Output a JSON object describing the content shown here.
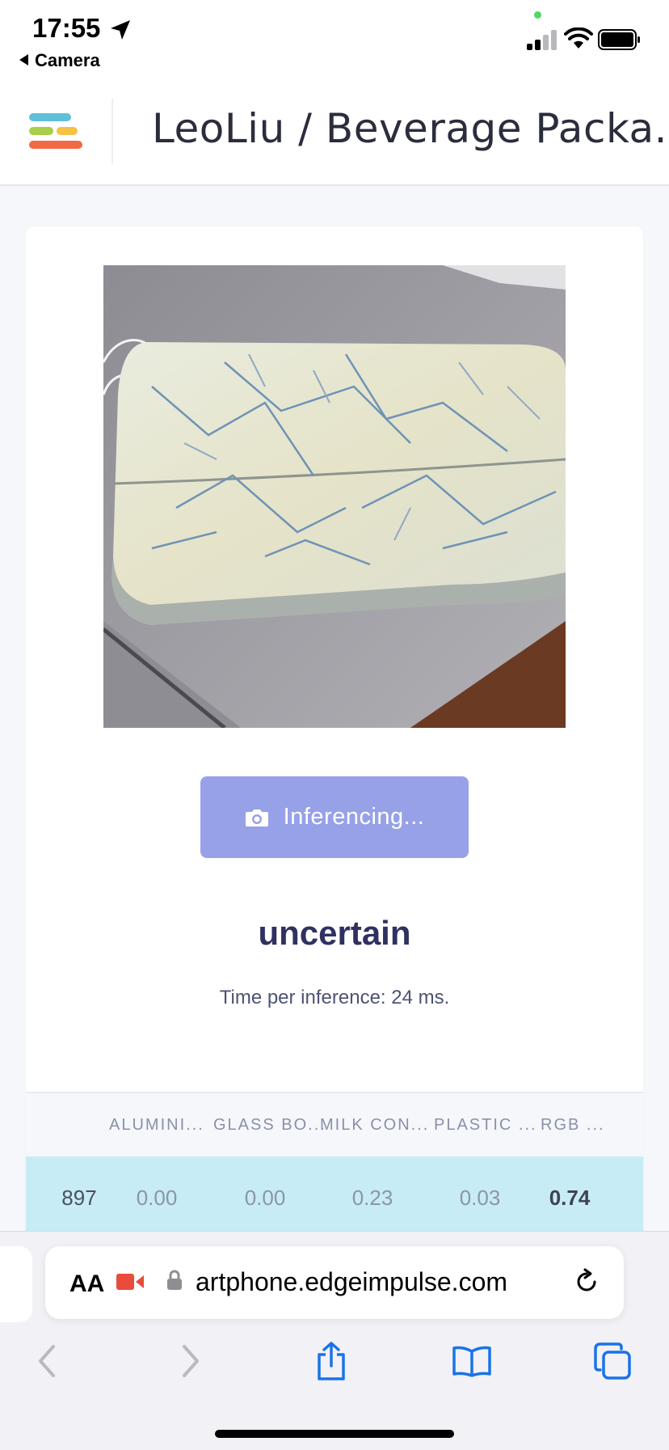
{
  "status_bar": {
    "time": "17:55",
    "back_app": "Camera"
  },
  "header": {
    "title": "LeoLiu / Beverage Packa..."
  },
  "main": {
    "button_label": "Inferencing...",
    "result": "uncertain",
    "inference_time": "Time per inference: 24 ms."
  },
  "table": {
    "columns": [
      "ALUMINI...",
      "GLASS BO...",
      "MILK CON...",
      "PLASTIC ...",
      "RGB ..."
    ],
    "row": {
      "index": "897",
      "values": [
        "0.00",
        "0.00",
        "0.23",
        "0.03",
        "0.74"
      ]
    }
  },
  "browser": {
    "text_size_label": "AA",
    "url": "artphone.edgeimpulse.com"
  },
  "colors": {
    "accent_button": "#97a1e8",
    "highlight_row": "#c8ecf6",
    "recording_red": "#e94b3c",
    "ios_blue": "#1a73e8"
  },
  "icons": [
    "location-arrow-icon",
    "signal-icon",
    "wifi-icon",
    "battery-icon",
    "logo-icon",
    "camera-icon",
    "recording-icon",
    "lock-icon",
    "reload-icon",
    "back-icon",
    "forward-icon",
    "share-icon",
    "bookmarks-icon",
    "tabs-icon"
  ]
}
